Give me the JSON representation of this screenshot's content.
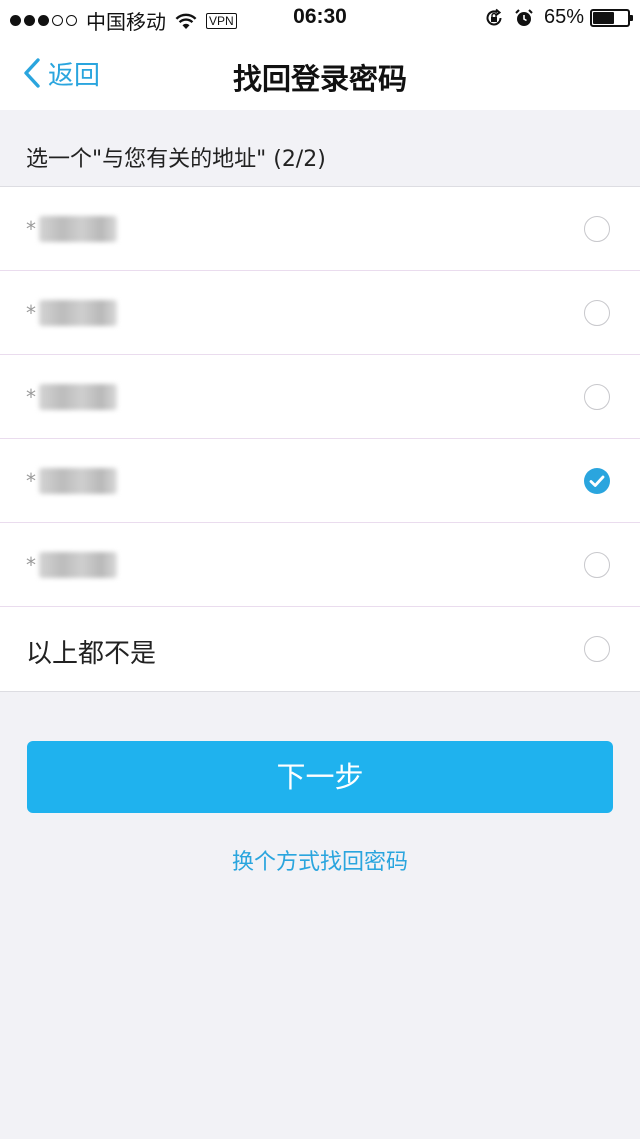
{
  "status_bar": {
    "carrier": "中国移动",
    "vpn": "VPN",
    "time": "06:30",
    "battery_percent": "65%",
    "battery_level": 0.65
  },
  "nav": {
    "back_label": "返回",
    "title": "找回登录密码"
  },
  "section": {
    "prompt": "选一个\"与您有关的地址\" (2/2)"
  },
  "options": [
    {
      "label": "",
      "blurred": true,
      "checked": false
    },
    {
      "label": "",
      "blurred": true,
      "checked": false
    },
    {
      "label": "",
      "blurred": true,
      "checked": false
    },
    {
      "label": "",
      "blurred": true,
      "checked": true
    },
    {
      "label": "",
      "blurred": true,
      "checked": false
    },
    {
      "label": "以上都不是",
      "blurred": false,
      "checked": false
    }
  ],
  "actions": {
    "next_label": "下一步",
    "alt_link": "换个方式找回密码"
  },
  "colors": {
    "accent": "#2aa5de",
    "button": "#1fb2ee",
    "background": "#f2f2f6"
  }
}
